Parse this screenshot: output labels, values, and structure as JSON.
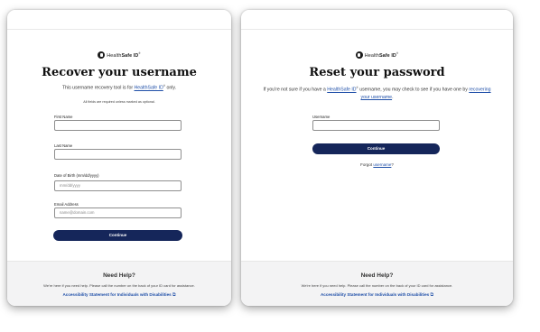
{
  "brand": {
    "name_prefix": "Health",
    "name_bold": "Safe ID",
    "trademark": "®"
  },
  "left": {
    "title": "Recover your username",
    "subtitle_before": "This username recovery tool is for ",
    "subtitle_link": "HealthSafe ID",
    "subtitle_after": " only.",
    "required_note": "All fields are required unless marked as optional.",
    "fields": [
      {
        "label": "First Name",
        "value": "",
        "placeholder": ""
      },
      {
        "label": "Last Name",
        "value": "",
        "placeholder": ""
      },
      {
        "label": "Date of Birth (mm/dd/yyyy)",
        "value": "",
        "placeholder": "mm/dd/yyyy"
      },
      {
        "label": "Email Address",
        "value": "",
        "placeholder": "name@domain.com"
      }
    ],
    "continue_label": "Continue"
  },
  "right": {
    "title": "Reset your password",
    "subtitle_before": "If you're not sure if you have a ",
    "subtitle_link": "HealthSafe ID",
    "subtitle_middle": " username, you may check to see if you have one by ",
    "subtitle_link2_a": "recovering",
    "subtitle_link2_b": "your username",
    "subtitle_end": ".",
    "username_label": "Username",
    "username_value": "",
    "continue_label": "Continue",
    "forgot_prefix": "Forgot ",
    "forgot_link": "username",
    "forgot_suffix": "?"
  },
  "footer": {
    "heading": "Need Help?",
    "description": "We're here if you need help. Please call the number on the back of your ID card for assistance.",
    "accessibility_link": "Accessibility Statement for Individuals with Disabilities",
    "external_icon": "external-link-icon"
  },
  "colors": {
    "button": "#15265a",
    "link": "#1f4fa8",
    "footer_bg": "#f3f3f4"
  }
}
